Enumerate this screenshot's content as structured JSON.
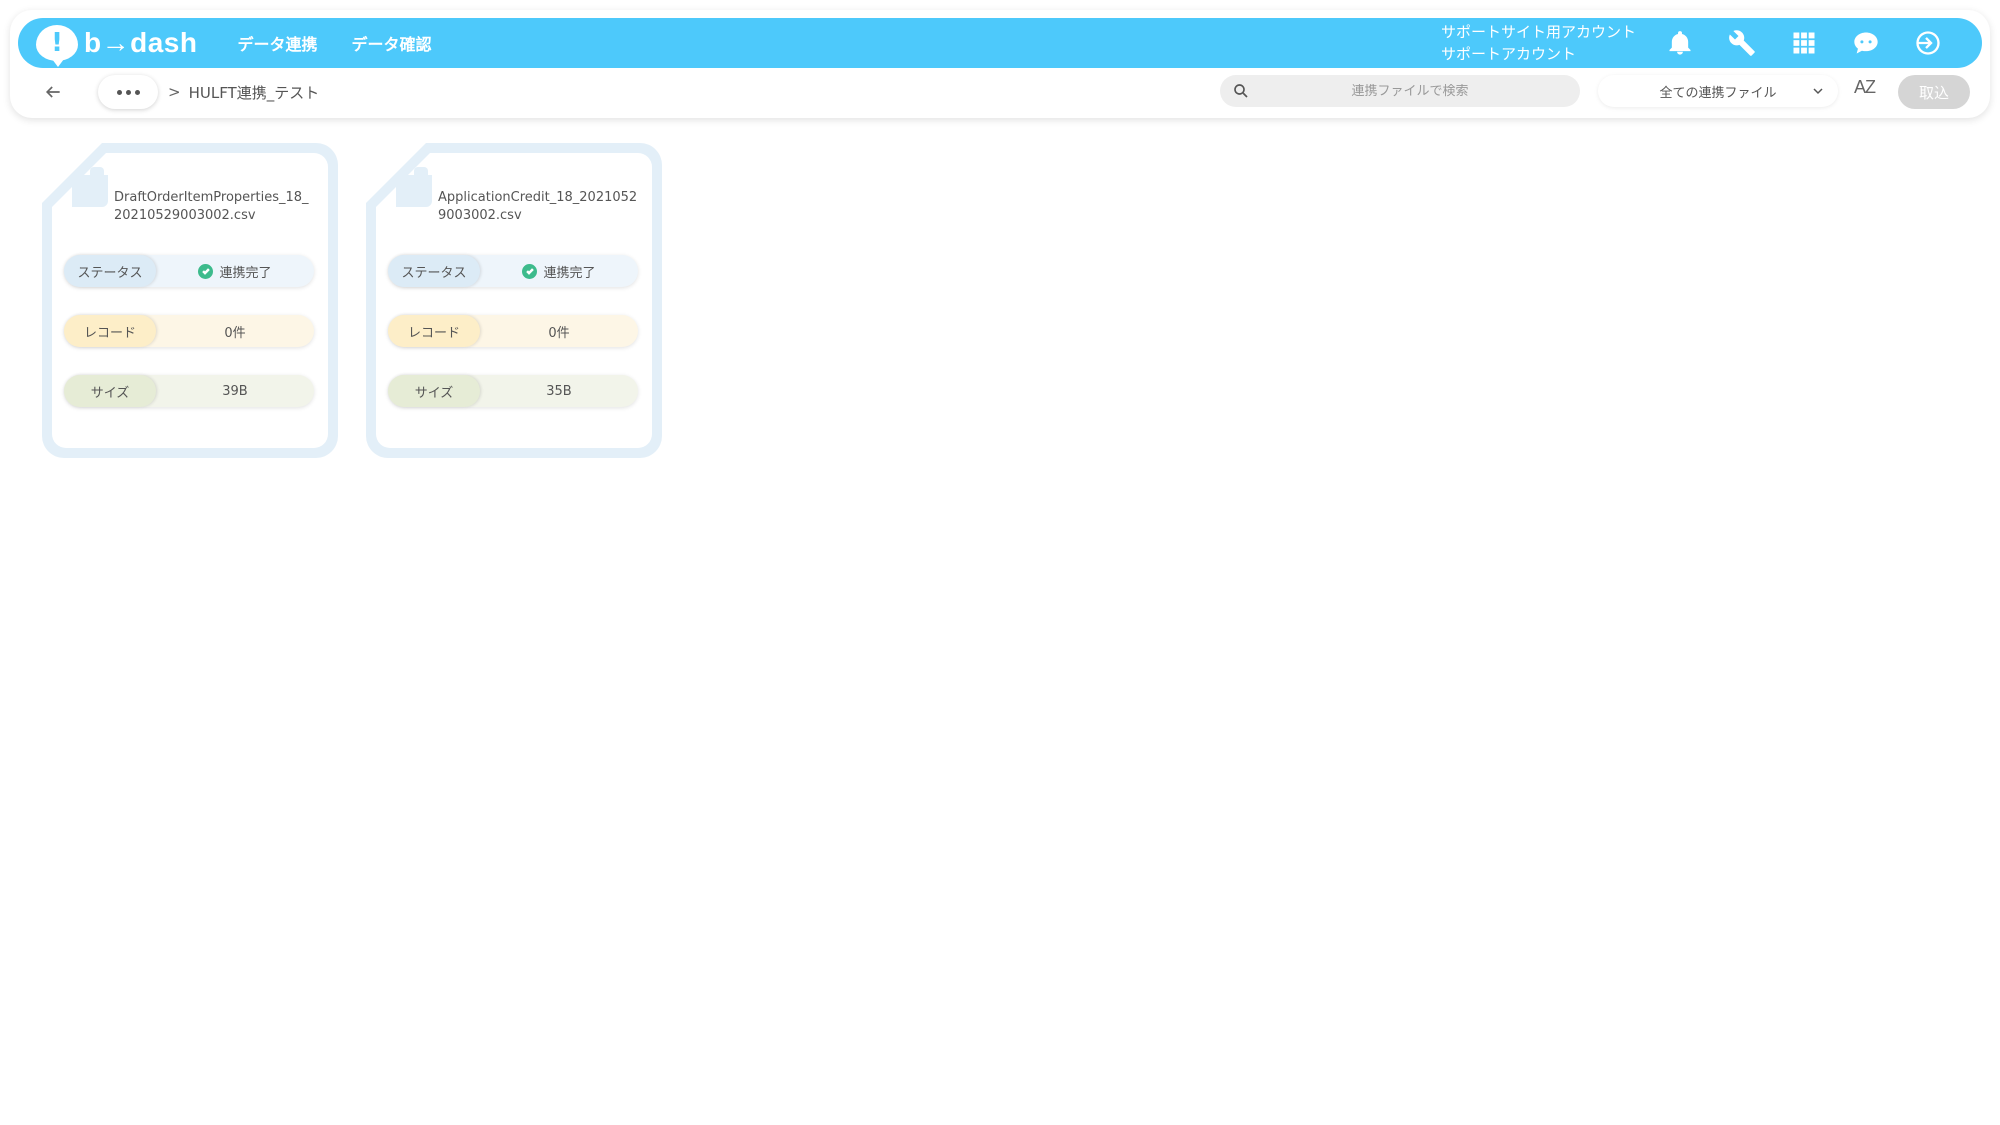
{
  "app": {
    "logo_text": "b→dash",
    "logo_mark": "!"
  },
  "nav": [
    {
      "label": "データ連携"
    },
    {
      "label": "データ確認"
    }
  ],
  "account": {
    "line1": "サポートサイト用アカウント",
    "line2": "サポートアカウント"
  },
  "header_icons": [
    "bell-icon",
    "wrench-icon",
    "grid-icon",
    "support-chat-icon",
    "logout-icon"
  ],
  "breadcrumb": {
    "separator": ">",
    "current": "HULFT連携_テスト"
  },
  "search": {
    "placeholder": "連携ファイルで検索",
    "value": ""
  },
  "filter": {
    "selected": "全ての連携ファイル"
  },
  "sort": {
    "label": "AZ"
  },
  "import_button": {
    "label": "取込"
  },
  "files": [
    {
      "filename": "DraftOrderItemProperties_18_20210529003002.csv",
      "status_label": "ステータス",
      "status_value": "連携完了",
      "record_label": "レコード",
      "record_value": "0件",
      "size_label": "サイズ",
      "size_value": "39B"
    },
    {
      "filename": "ApplicationCredit_18_20210529003002.csv",
      "status_label": "ステータス",
      "status_value": "連携完了",
      "record_label": "レコード",
      "record_value": "0件",
      "size_label": "サイズ",
      "size_value": "35B"
    }
  ],
  "colors": {
    "brand": "#4dc9fb",
    "success": "#3dbb8c",
    "card_frame": "#e3eff8"
  }
}
